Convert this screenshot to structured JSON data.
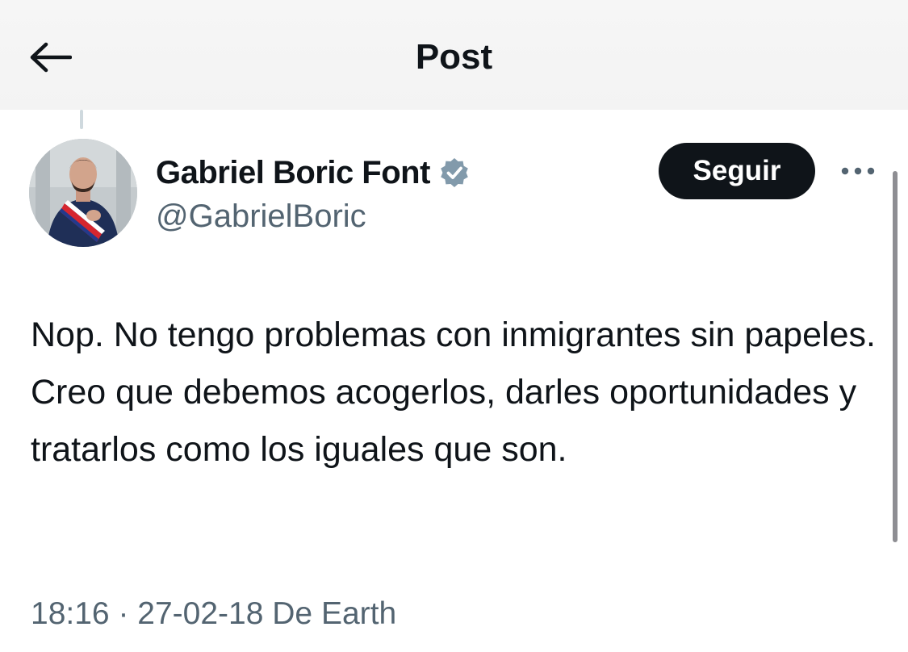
{
  "header": {
    "title": "Post",
    "back_icon": "arrow-left-icon"
  },
  "author": {
    "display_name": "Gabriel Boric Font",
    "handle": "@GabrielBoric",
    "verified_icon": "verified-badge-icon",
    "verified_color": "#829aab"
  },
  "actions": {
    "follow_label": "Seguir",
    "more_icon": "more-horizontal-icon"
  },
  "tweet": {
    "text": "Nop. No tengo problemas con inmigrantes sin papeles. Creo que debemos acogerlos, darles oportunidades y tratarlos como los iguales que son."
  },
  "meta": {
    "time": "18:16",
    "separator": "·",
    "date": "27-02-18",
    "source": "De Earth"
  },
  "colors": {
    "text_primary": "#0f1419",
    "text_secondary": "#536471",
    "follow_bg": "#0f1419",
    "follow_text": "#ffffff"
  }
}
